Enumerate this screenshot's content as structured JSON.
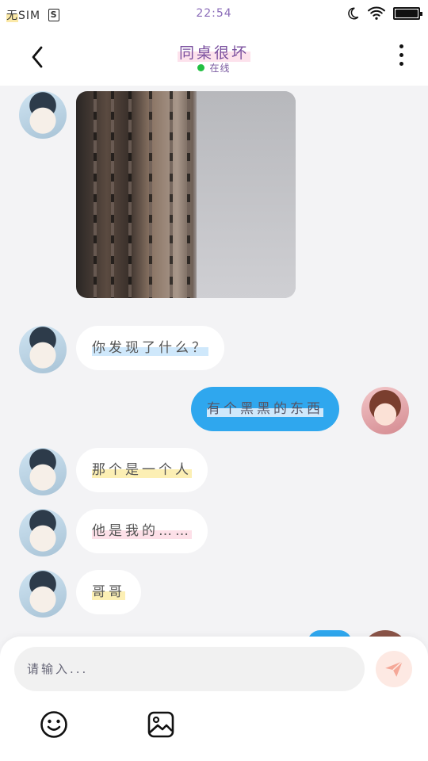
{
  "status_bar": {
    "carrier_first": "无",
    "carrier_rest": "SIM",
    "sim_icon_label": "S",
    "time": "22:54",
    "battery_level": 1.0,
    "icons": [
      "sim-card-icon",
      "moon-icon",
      "wifi-icon",
      "battery-icon"
    ]
  },
  "header": {
    "back_icon": "chevron-left-icon",
    "title": "同桌很坏",
    "online_status": "在线",
    "online_color": "#23c043",
    "more_icon": "more-vertical-icon"
  },
  "messages": [
    {
      "side": "in",
      "type": "image",
      "sender_avatar": "avatar-boy"
    },
    {
      "side": "in",
      "type": "text",
      "text": "你发现了什么？",
      "sender_avatar": "avatar-boy"
    },
    {
      "side": "out",
      "type": "text",
      "text": "有个黑黑的东西",
      "sender_avatar": "avatar-girl"
    },
    {
      "side": "in",
      "type": "text",
      "text": "那个是一个人",
      "sender_avatar": "avatar-boy"
    },
    {
      "side": "in",
      "type": "text",
      "text": "他是我的……",
      "sender_avatar": "avatar-boy"
    },
    {
      "side": "in",
      "type": "text",
      "text": "哥哥",
      "sender_avatar": "avatar-boy"
    }
  ],
  "composer": {
    "placeholder": "请输入...",
    "send_icon": "send-icon",
    "emoji_icon": "emoji-icon",
    "image_icon": "image-icon"
  },
  "colors": {
    "outgoing_bubble": "#2fa7ee",
    "incoming_bubble": "#ffffff",
    "background": "#f3f3f5",
    "send_button": "#fde9e3",
    "send_icon": "#f5a898"
  }
}
